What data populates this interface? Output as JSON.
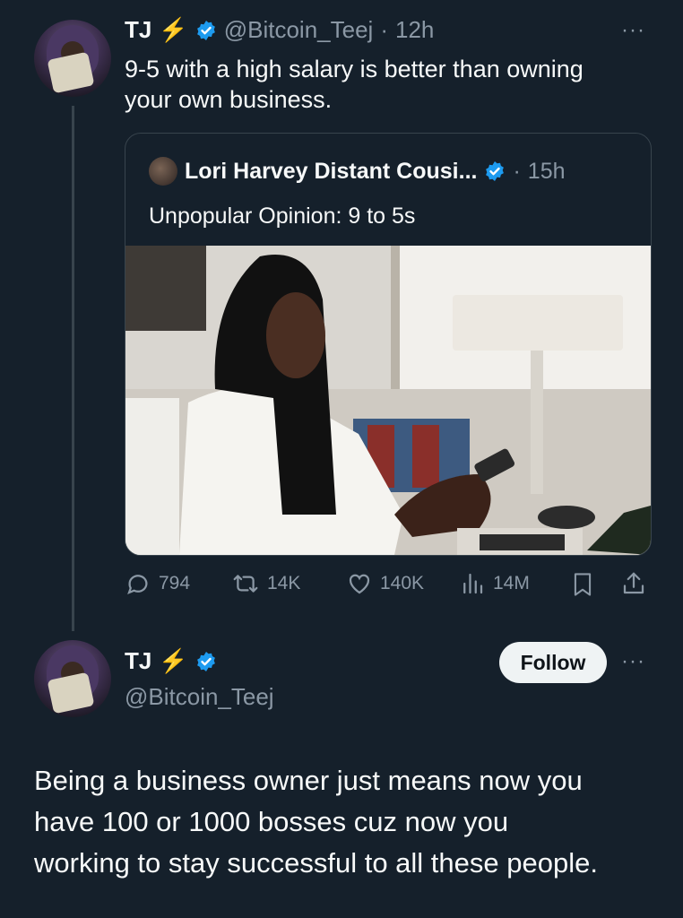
{
  "tweet": {
    "name": "TJ",
    "bolt": "⚡",
    "handle": "@Bitcoin_Teej",
    "separator": "·",
    "time": "12h",
    "text_line1": "9-5 with a high salary is better than owning",
    "text_line2": "your own business.",
    "more": "···"
  },
  "quote": {
    "name": "Lori Harvey Distant Cousi...",
    "separator": "·",
    "time": "15h",
    "text": "Unpopular Opinion: 9 to 5s"
  },
  "actions": {
    "replies": "794",
    "retweets": "14K",
    "likes": "140K",
    "views": "14M"
  },
  "reply": {
    "name": "TJ",
    "bolt": "⚡",
    "handle": "@Bitcoin_Teej",
    "follow_label": "Follow",
    "more": "···",
    "text_line1": "Being a business owner just means now you",
    "text_line2": "have 100 or 1000 bosses cuz now you",
    "text_line3": "working to stay successful to all these people."
  },
  "colors": {
    "background": "#15202b",
    "verified": "#1d9bf0",
    "bolt": "#f5c518",
    "muted": "#8b98a5"
  }
}
